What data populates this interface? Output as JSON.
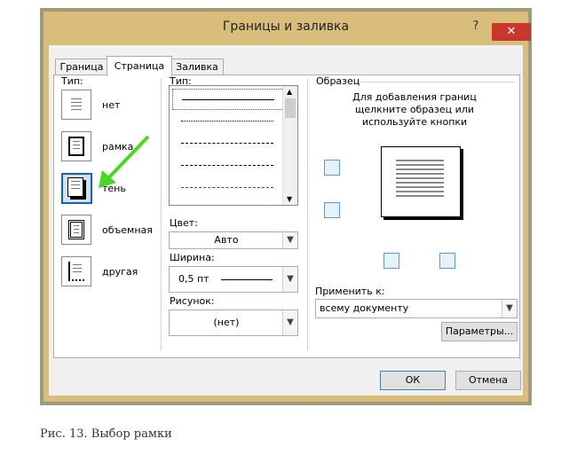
{
  "dialog": {
    "title": "Границы и заливка",
    "help": "?",
    "close": "✕"
  },
  "tabs": [
    {
      "label": "Граница"
    },
    {
      "label": "Страница"
    },
    {
      "label": "Заливка"
    }
  ],
  "setting": {
    "label": "Тип:",
    "options": [
      {
        "label": "нет"
      },
      {
        "label": "рамка"
      },
      {
        "label": "тень"
      },
      {
        "label": "объемная"
      },
      {
        "label": "другая"
      }
    ],
    "selected": "тень"
  },
  "style": {
    "label": "Тип:"
  },
  "color": {
    "label": "Цвет:",
    "value": "Авто"
  },
  "width": {
    "label": "Ширина:",
    "value": "0,5 пт"
  },
  "art": {
    "label": "Рисунок:",
    "value": "(нет)"
  },
  "preview": {
    "label": "Образец",
    "hint_line1": "Для добавления границ",
    "hint_line2": "щелкните образец или",
    "hint_line3": "используйте кнопки"
  },
  "apply_to": {
    "label": "Применить к:",
    "value": "всему документу"
  },
  "buttons": {
    "options": "Параметры...",
    "ok": "ОК",
    "cancel": "Отмена"
  },
  "caption": "Рис. 13. Выбор рамки",
  "colors": {
    "frame": "#d8be7a",
    "close": "#c7372e",
    "arrow": "#4cd427"
  }
}
